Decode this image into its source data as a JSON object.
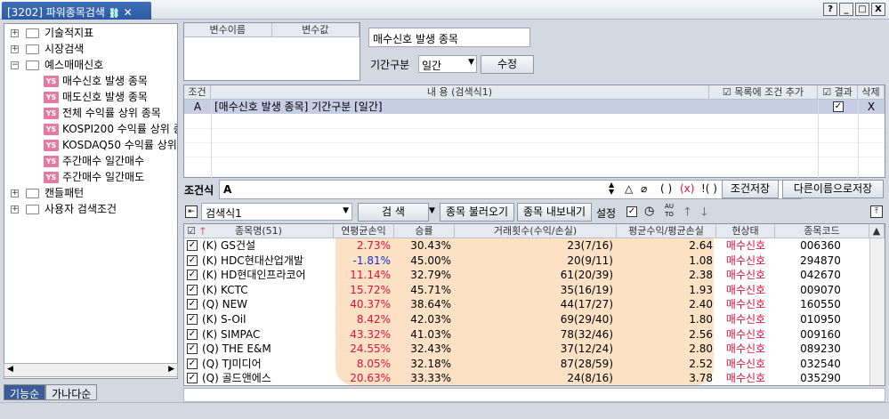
{
  "window": {
    "tab_title": "[3202] 파워종목검색",
    "tab_icon": "link-icon",
    "buttons": [
      "?",
      "_",
      "□",
      "X"
    ]
  },
  "tree": {
    "items": [
      {
        "label": "기술적지표",
        "type": "folder"
      },
      {
        "label": "시장검색",
        "type": "folder"
      },
      {
        "label": "예스매매신호",
        "type": "folder"
      },
      {
        "label": "매수신호 발생 종목",
        "type": "ys",
        "selected": true
      },
      {
        "label": "매도신호 발생 종목",
        "type": "ys"
      },
      {
        "label": "전체 수익률 상위 종목",
        "type": "ys"
      },
      {
        "label": "KOSPI200 수익률 상위 종",
        "type": "ys"
      },
      {
        "label": "KOSDAQ50 수익률 상위",
        "type": "ys"
      },
      {
        "label": "주간매수 일간매수",
        "type": "ys"
      },
      {
        "label": "주간매수 일간매도",
        "type": "ys"
      },
      {
        "label": "캔들패턴",
        "type": "folder"
      },
      {
        "label": "사용자 검색조건",
        "type": "folder"
      }
    ],
    "bottom_tabs": [
      "기능순",
      "가나다순"
    ]
  },
  "variables": {
    "col_name": "변수이름",
    "col_value": "변수값"
  },
  "condition_panel": {
    "name": "매수신호 발생 종목",
    "period_label": "기간구분",
    "period_value": "일간",
    "edit_button": "수정"
  },
  "condition_grid": {
    "headers": {
      "cond": "조건",
      "content": "내        용 (검색식1)",
      "add": "목록에 조건 추가",
      "result": "결과",
      "delete": "삭제"
    },
    "rows": [
      {
        "cond": "A",
        "content": "[매수신호 발생 종목] 기간구분 [일간]",
        "result": true,
        "delete": "X"
      }
    ]
  },
  "expression": {
    "label": "조건식",
    "value": "A",
    "symbols": [
      "△",
      "⌀",
      "( )",
      "(x)",
      "!( )"
    ],
    "save_button": "조건저장",
    "save_as_button": "다른이름으로저장"
  },
  "search_toolbar": {
    "formula_select": "검색식1",
    "search_button": "검      색",
    "load_button": "종목 불러오기",
    "export_button": "종목 내보내기",
    "settings_button": "설정",
    "auto_label": "AU TO"
  },
  "results": {
    "headers": {
      "name": "종목명(51)",
      "annual": "연평균손익",
      "win": "승률",
      "trades": "거래횟수(수익/손실)",
      "ratio": "평균수익/평균손실",
      "state": "현상태",
      "code": "종목코드"
    },
    "rows": [
      {
        "name": "(K) GS건설",
        "annual": "2.73%",
        "win": "30.43%",
        "trades": "23(7/16)",
        "ratio": "2.64",
        "state": "매수신호",
        "code": "006360",
        "annual_color": "red"
      },
      {
        "name": "(K) HDC현대산업개발",
        "annual": "-1.81%",
        "win": "45.00%",
        "trades": "20(9/11)",
        "ratio": "1.08",
        "state": "매수신호",
        "code": "294870",
        "annual_color": "blue"
      },
      {
        "name": "(K) HD현대인프라코어",
        "annual": "11.14%",
        "win": "32.79%",
        "trades": "61(20/39)",
        "ratio": "2.38",
        "state": "매수신호",
        "code": "042670",
        "annual_color": "red"
      },
      {
        "name": "(K) KCTC",
        "annual": "15.72%",
        "win": "45.71%",
        "trades": "35(16/19)",
        "ratio": "1.93",
        "state": "매수신호",
        "code": "009070",
        "annual_color": "red"
      },
      {
        "name": "(Q) NEW",
        "annual": "40.37%",
        "win": "38.64%",
        "trades": "44(17/27)",
        "ratio": "2.40",
        "state": "매수신호",
        "code": "160550",
        "annual_color": "red"
      },
      {
        "name": "(K) S-Oil",
        "annual": "8.42%",
        "win": "42.03%",
        "trades": "69(29/40)",
        "ratio": "1.80",
        "state": "매수신호",
        "code": "010950",
        "annual_color": "red"
      },
      {
        "name": "(K) SIMPAC",
        "annual": "43.32%",
        "win": "41.03%",
        "trades": "78(32/46)",
        "ratio": "2.56",
        "state": "매수신호",
        "code": "009160",
        "annual_color": "red"
      },
      {
        "name": "(Q) THE E&M",
        "annual": "24.55%",
        "win": "32.43%",
        "trades": "37(12/24)",
        "ratio": "2.80",
        "state": "매수신호",
        "code": "089230",
        "annual_color": "red"
      },
      {
        "name": "(Q) TJ미디어",
        "annual": "8.05%",
        "win": "32.18%",
        "trades": "87(28/59)",
        "ratio": "2.52",
        "state": "매수신호",
        "code": "032540",
        "annual_color": "red"
      },
      {
        "name": "(Q) 골드앤에스",
        "annual": "20.63%",
        "win": "33.33%",
        "trades": "24(8/16)",
        "ratio": "3.78",
        "state": "매수신호",
        "code": "035290",
        "annual_color": "red"
      }
    ]
  },
  "colors": {
    "tab_blue": "#2b5aa3",
    "highlight": "#f9c896",
    "positive": "#e0103a",
    "negative": "#1030d0",
    "selected_row": "#c8cde6"
  }
}
